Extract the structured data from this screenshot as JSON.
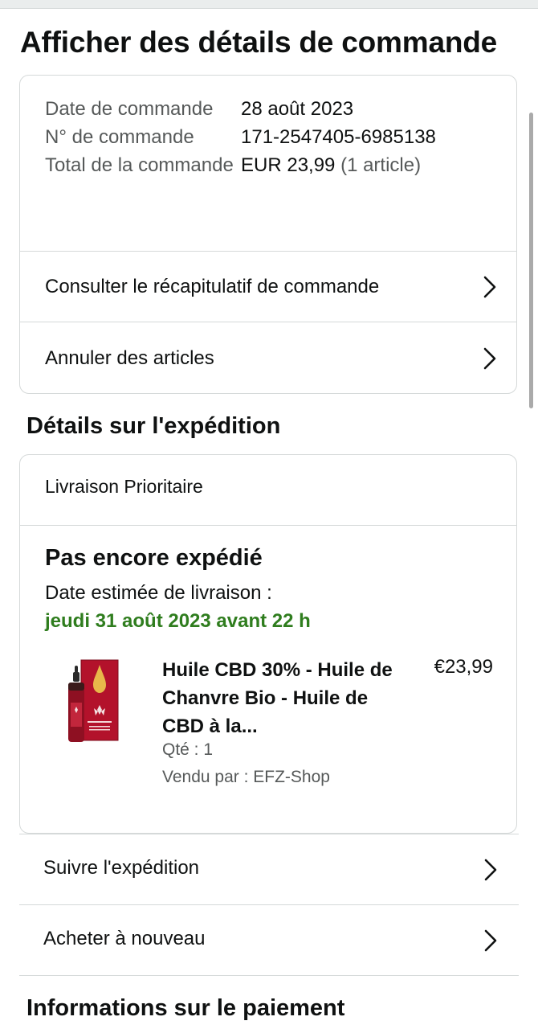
{
  "page": {
    "title": "Afficher des détails de commande"
  },
  "order": {
    "date_label": "Date de commande",
    "date_value": "28 août 2023",
    "number_label": "N° de commande",
    "number_value": "171-2547405-6985138",
    "total_label": "Total de la commande",
    "total_value": "EUR 23,99",
    "total_count": "(1 article)",
    "summary_link": "Consulter le récapitulatif de commande",
    "cancel_link": "Annuler des articles"
  },
  "shipping": {
    "section_title": "Détails sur l'expédition",
    "method": "Livraison Prioritaire",
    "status": "Pas encore expédié",
    "eta_label": "Date estimée de livraison :",
    "eta_date": "jeudi 31 août 2023 avant 22 h",
    "eta_color": "#2f7d1e",
    "product": {
      "title": "Huile CBD 30% - Huile de Chanvre Bio - Huile de CBD à la...",
      "price": "€23,99",
      "quantity": "Qté : 1",
      "seller": "Vendu par : EFZ-Shop"
    }
  },
  "actions": {
    "track": "Suivre l'expédition",
    "buy_again": "Acheter à nouveau"
  },
  "payment": {
    "section_title": "Informations sur le paiement"
  },
  "icons": {
    "chevron": "chevron-right-icon"
  }
}
